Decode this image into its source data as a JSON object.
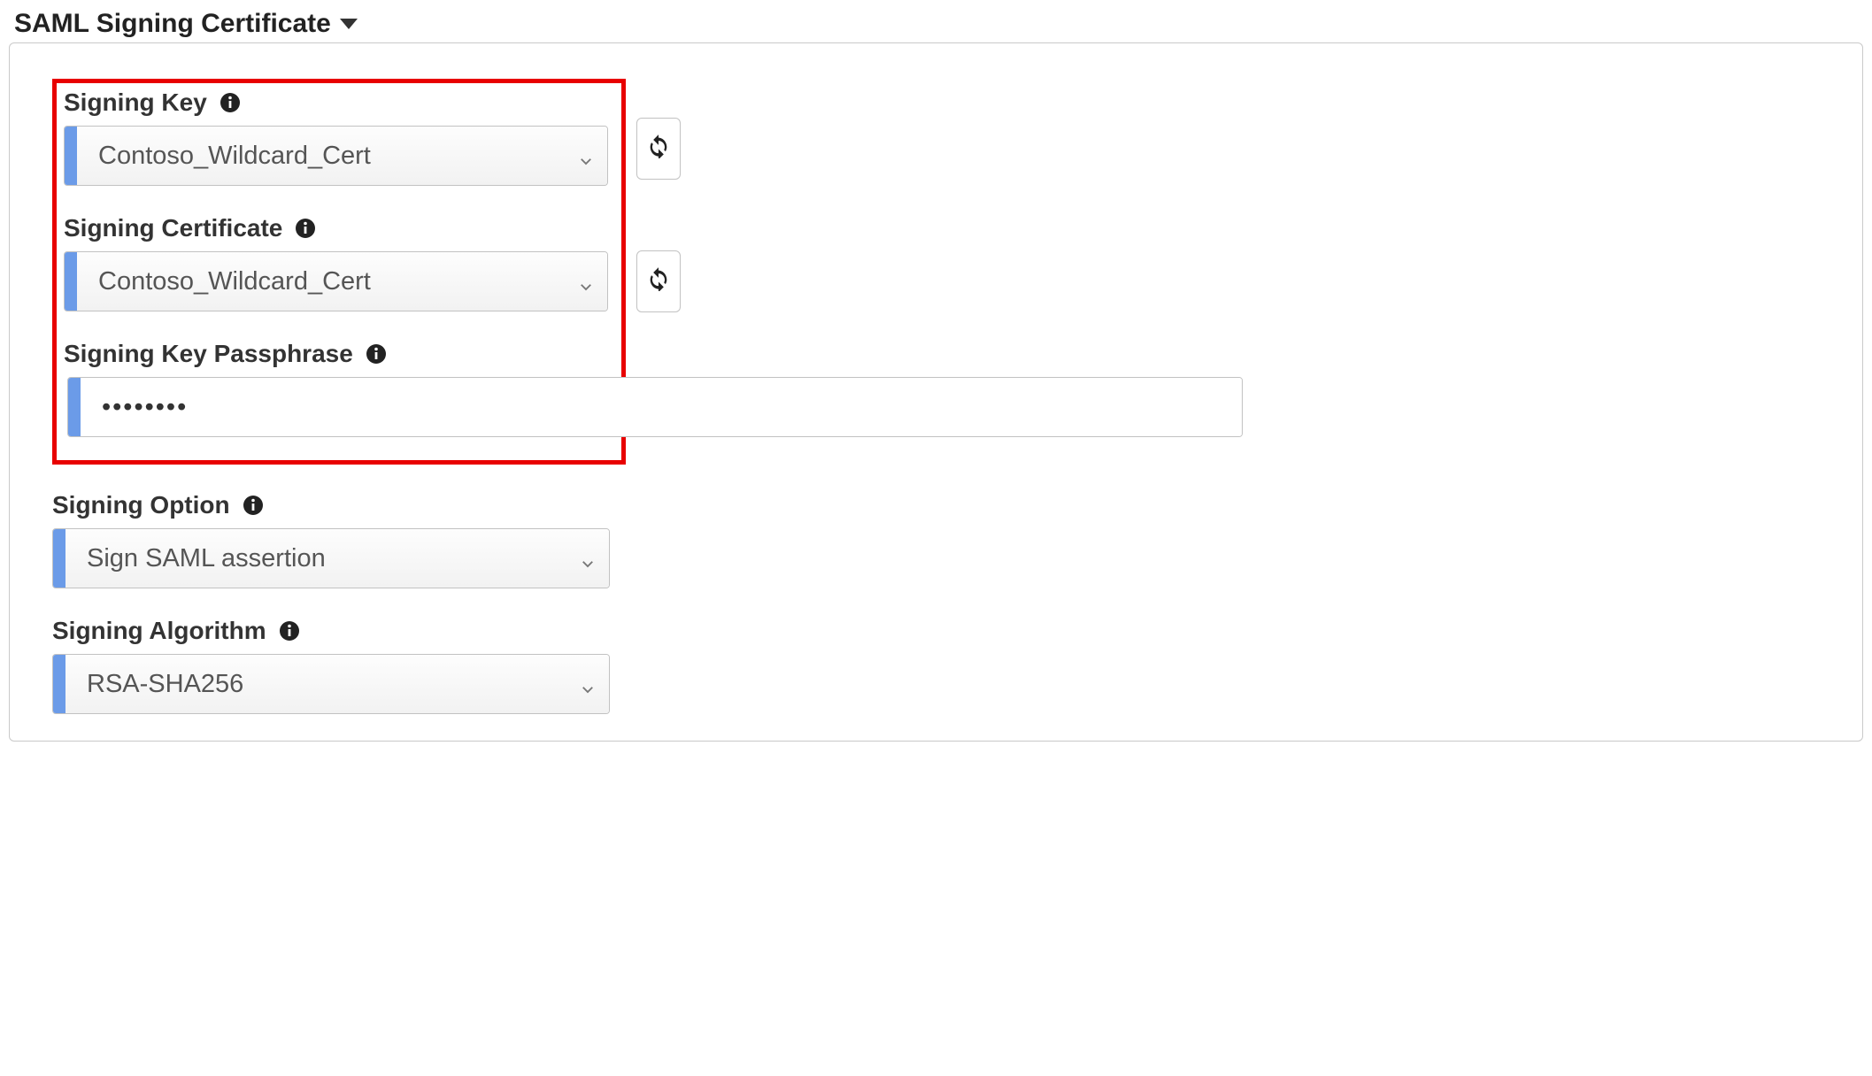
{
  "section": {
    "title": "SAML Signing Certificate"
  },
  "fields": {
    "signing_key": {
      "label": "Signing Key",
      "value": "Contoso_Wildcard_Cert"
    },
    "signing_cert": {
      "label": "Signing Certificate",
      "value": "Contoso_Wildcard_Cert"
    },
    "passphrase": {
      "label": "Signing Key Passphrase",
      "value": "••••••••"
    },
    "signing_option": {
      "label": "Signing Option",
      "value": "Sign SAML assertion"
    },
    "signing_algorithm": {
      "label": "Signing Algorithm",
      "value": "RSA-SHA256"
    }
  }
}
